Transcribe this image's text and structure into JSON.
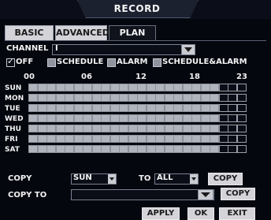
{
  "window": {
    "title": "RECORD"
  },
  "tabs": [
    {
      "label": "BASIC",
      "active": false
    },
    {
      "label": "ADVANCED",
      "active": false
    },
    {
      "label": "PLAN",
      "active": true
    }
  ],
  "channel": {
    "label": "CHANNEL",
    "value": "I"
  },
  "legend": [
    {
      "label": "OFF",
      "checked": true
    },
    {
      "label": "SCHEDULE"
    },
    {
      "label": "ALARM"
    },
    {
      "label": "SCHEDULE&ALARM"
    }
  ],
  "hours": [
    "00",
    "06",
    "12",
    "18",
    "23"
  ],
  "days": [
    "SUN",
    "MON",
    "TUE",
    "WED",
    "THU",
    "FRI",
    "SAT"
  ],
  "schedule": {
    "scheduled_hours": 21,
    "off_hours": 3,
    "fill_color": "#b0b4bc",
    "off_color": "#0a0d16"
  },
  "copy": {
    "label": "COPY",
    "from_day": "SUN",
    "to_label": "TO",
    "to_value": "ALL",
    "button": "COPY"
  },
  "copy_to": {
    "label": "COPY TO",
    "value": "",
    "button": "COPY"
  },
  "footer": {
    "apply": "APPLY",
    "ok": "OK",
    "exit": "EXIT"
  }
}
